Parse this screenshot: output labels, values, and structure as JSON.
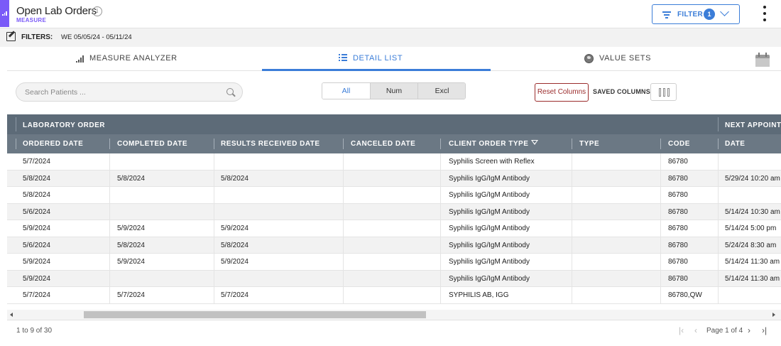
{
  "header": {
    "title": "Open Lab Orders",
    "subtitle": "MEASURE",
    "info_glyph": "i",
    "filter_label": "FILTER",
    "filter_count": "1",
    "icons": [
      "chart-icon",
      "info-icon",
      "filter-lines-icon",
      "chevron-down-icon",
      "kebab-menu-icon"
    ]
  },
  "filters": {
    "label": "FILTERS:",
    "value": "WE 05/05/24 - 05/11/24"
  },
  "tabs": [
    {
      "label": "MEASURE ANALYZER",
      "icon": "signal-bars-icon",
      "active": false
    },
    {
      "label": "DETAIL LIST",
      "icon": "list-icon",
      "active": true
    },
    {
      "label": "VALUE SETS",
      "icon": "globe-icon",
      "active": false
    }
  ],
  "toolbar": {
    "search_placeholder": "Search Patients ...",
    "segments": [
      "All",
      "Num",
      "Excl"
    ],
    "selected_segment": "All",
    "reset_label": "Reset Columns",
    "saved_columns_label": "SAVED COLUMNS"
  },
  "table": {
    "group_headers": [
      "LABORATORY ORDER",
      "NEXT APPOINT"
    ],
    "columns": [
      "ORDERED DATE",
      "COMPLETED DATE",
      "RESULTS RECEIVED DATE",
      "CANCELED DATE",
      "CLIENT ORDER TYPE",
      "TYPE",
      "CODE",
      "DATE"
    ],
    "rows": [
      [
        "5/7/2024",
        "",
        "",
        "",
        "Syphilis Screen with Reflex",
        "",
        "86780",
        ""
      ],
      [
        "5/8/2024",
        "5/8/2024",
        "5/8/2024",
        "",
        "Syphilis IgG/IgM Antibody",
        "",
        "86780",
        "5/29/24 10:20 am"
      ],
      [
        "5/8/2024",
        "",
        "",
        "",
        "Syphilis IgG/IgM Antibody",
        "",
        "86780",
        ""
      ],
      [
        "5/6/2024",
        "",
        "",
        "",
        "Syphilis IgG/IgM Antibody",
        "",
        "86780",
        "5/14/24 10:30 am"
      ],
      [
        "5/9/2024",
        "5/9/2024",
        "5/9/2024",
        "",
        "Syphilis IgG/IgM Antibody",
        "",
        "86780",
        "5/14/24 5:00 pm"
      ],
      [
        "5/6/2024",
        "5/8/2024",
        "5/8/2024",
        "",
        "Syphilis IgG/IgM Antibody",
        "",
        "86780",
        "5/24/24 8:30 am"
      ],
      [
        "5/9/2024",
        "5/9/2024",
        "5/9/2024",
        "",
        "Syphilis IgG/IgM Antibody",
        "",
        "86780",
        "5/14/24 11:30 am"
      ],
      [
        "5/9/2024",
        "",
        "",
        "",
        "Syphilis IgG/IgM Antibody",
        "",
        "86780",
        "5/14/24 11:30 am"
      ],
      [
        "5/7/2024",
        "5/7/2024",
        "5/7/2024",
        "",
        "SYPHILIS AB, IGG",
        "",
        "86780,QW",
        ""
      ]
    ]
  },
  "footer": {
    "count": "1 to 9 of 30",
    "page_label": "Page 1 of 4",
    "first_glyph": "|‹",
    "prev_glyph": "‹",
    "next_glyph": "›",
    "last_glyph": "›|"
  },
  "colors": {
    "accent": "#3b7dd8",
    "brand": "#7a5af8",
    "reset": "#9b2c2c",
    "table_header": "#5d6b78"
  }
}
